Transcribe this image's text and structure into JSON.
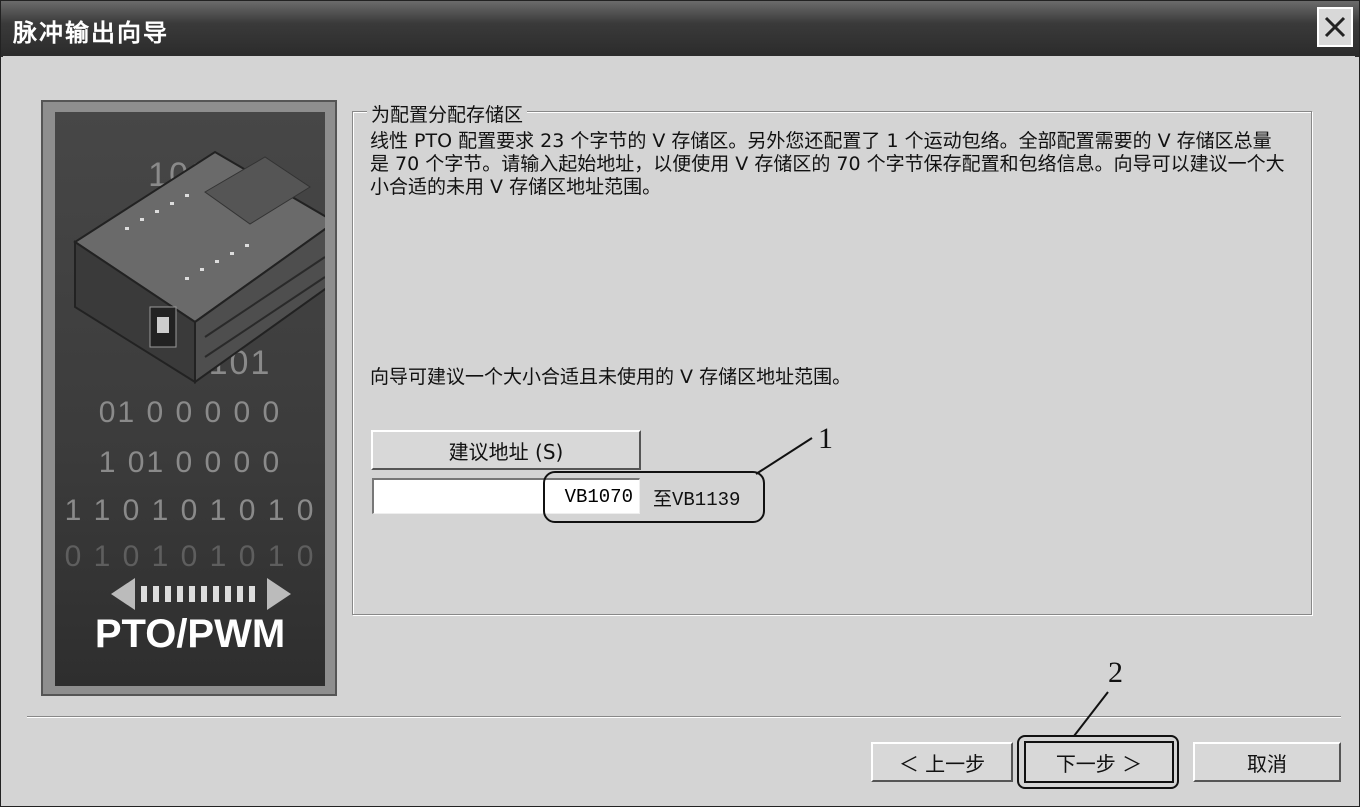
{
  "window": {
    "title": "脉冲输出向导",
    "close_icon": "close-icon"
  },
  "image_panel": {
    "binary_rows": [
      "1001",
      "101",
      "1",
      "101",
      "01 0 0 0 0 0",
      "1 01 0 0 0 0",
      "1 1 0 1 0 1 0 1 0",
      "0 1 0 1 0 1 0 1 0"
    ],
    "caption": "PTO/PWM",
    "icon": "plc-device-icon"
  },
  "group": {
    "legend": "为配置分配存储区",
    "description": "线性 PTO 配置要求 23 个字节的 V 存储区。另外您还配置了 1 个运动包络。全部配置需要的 V 存储区总量是 70 个字节。请输入起始地址，以便使用 V 存储区的 70 个字节保存配置和包络信息。向导可以建议一个大小合适的未用 V 存储区地址范围。",
    "suggest_text": "向导可建议一个大小合适且未使用的 V 存储区地址范围。",
    "suggest_button": "建议地址 (S)",
    "address_value": "VB1070",
    "range_text": "至VB1139"
  },
  "annotations": {
    "label_1": "1",
    "label_2": "2"
  },
  "footer": {
    "back_label": "＜ 上一步",
    "next_label": "下一步 ＞",
    "cancel_label": "取消"
  }
}
